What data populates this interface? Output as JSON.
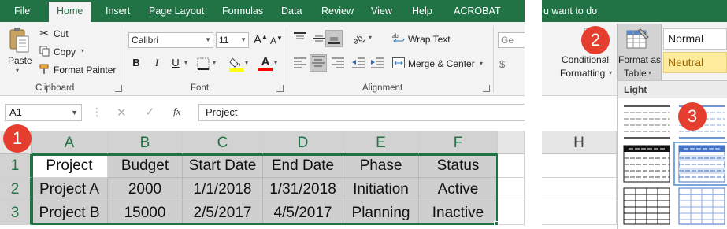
{
  "ribbon_tabs": [
    "File",
    "Home",
    "Insert",
    "Page Layout",
    "Formulas",
    "Data",
    "Review",
    "View",
    "Help",
    "ACROBAT"
  ],
  "active_tab": "Home",
  "tell_me": "u want to do",
  "clipboard": {
    "paste_label": "Paste",
    "cut_label": "Cut",
    "copy_label": "Copy",
    "format_painter_label": "Format Painter",
    "group_label": "Clipboard"
  },
  "font": {
    "family": "Calibri",
    "size": "11",
    "bold": "B",
    "italic": "I",
    "underline": "U",
    "font_color_glyph": "A",
    "group_label": "Font"
  },
  "alignment": {
    "wrap_text_label": "Wrap Text",
    "merge_center_label": "Merge & Center",
    "group_label": "Alignment"
  },
  "number": {
    "format_partial": "Ge"
  },
  "styles": {
    "conditional_formatting_line1": "Conditional",
    "conditional_formatting_line2": "Formatting",
    "format_as_table_line1": "Format as",
    "format_as_table_line2": "Table",
    "style_normal": "Normal",
    "style_neutral": "Neutral"
  },
  "formula_bar": {
    "name_box": "A1",
    "fx_label": "fx",
    "content": "Project"
  },
  "grid": {
    "columns": [
      "A",
      "B",
      "C",
      "D",
      "E",
      "F"
    ],
    "extra_column": "H",
    "rows": [
      "1",
      "2",
      "3"
    ],
    "cells": [
      [
        "Project",
        "Budget",
        "Start Date",
        "End Date",
        "Phase",
        "Status"
      ],
      [
        "Project A",
        "2000",
        "1/1/2018",
        "1/31/2018",
        "Initiation",
        "Active"
      ],
      [
        "Project B",
        "15000",
        "2/5/2017",
        "4/5/2017",
        "Planning",
        "Inactive"
      ]
    ]
  },
  "gallery": {
    "section_label": "Light"
  },
  "callouts": [
    "1",
    "2",
    "3"
  ],
  "colors": {
    "ribbon_green": "#217346",
    "callout_red": "#e53d2e",
    "selection_gray": "#cfcfcf",
    "neutral_fill": "#ffeb9c"
  }
}
